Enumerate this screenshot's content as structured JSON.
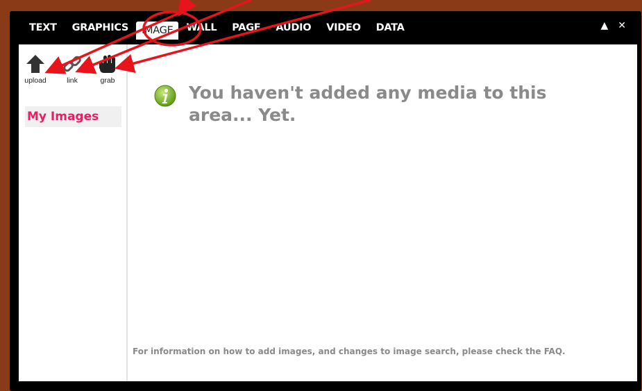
{
  "tabs": [
    {
      "label": "TEXT"
    },
    {
      "label": "GRAPHICS"
    },
    {
      "label": "IMAGE"
    },
    {
      "label": "WALL"
    },
    {
      "label": "PAGE"
    },
    {
      "label": "AUDIO"
    },
    {
      "label": "VIDEO"
    },
    {
      "label": "DATA"
    }
  ],
  "window_controls": {
    "collapse": "▲",
    "close": "✕"
  },
  "tools": [
    {
      "label": "upload",
      "icon": "upload-icon"
    },
    {
      "label": "link",
      "icon": "link-icon"
    },
    {
      "label": "grab",
      "icon": "grab-hand-icon"
    }
  ],
  "sidebar": {
    "my_images": "My Images"
  },
  "main": {
    "empty_message": "You haven't added any media to this area... Yet.",
    "faq_note": "For information on how to add images, and changes to image search, please check the FAQ."
  },
  "colors": {
    "accent_pink": "#e91e63",
    "annotation_red": "#e8141b",
    "info_green": "#7fbf2a",
    "background_brown": "#8a3a17"
  }
}
